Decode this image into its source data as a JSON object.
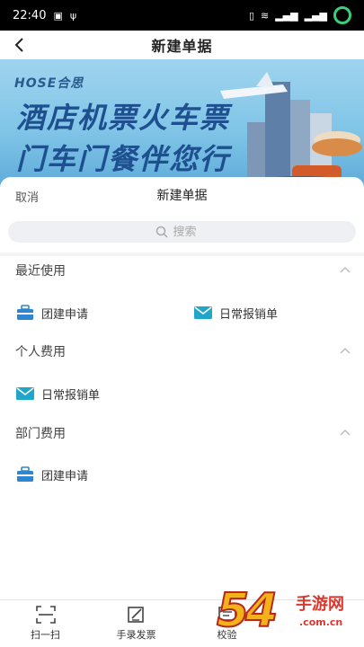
{
  "status_bar": {
    "time": "22:40"
  },
  "header": {
    "title": "新建单据"
  },
  "banner": {
    "logo": "HOSE合思",
    "line1": "酒店机票火车票",
    "line2": "门车门餐伴您行"
  },
  "sheet": {
    "cancel_label": "取消",
    "title": "新建单据",
    "search_placeholder": "搜索",
    "sections": [
      {
        "label": "最近使用",
        "items": [
          "团建申请",
          "日常报销单"
        ]
      },
      {
        "label": "个人费用",
        "items": [
          "日常报销单"
        ]
      },
      {
        "label": "部门费用",
        "items": [
          "团建申请"
        ]
      }
    ]
  },
  "bottom_nav": {
    "items": [
      "扫一扫",
      "手录发票",
      "校验"
    ]
  },
  "watermark": {
    "number": "54",
    "text": "手游网",
    "url": ".com.cn"
  },
  "colors": {
    "accent": "#2f7cc0",
    "mail_teal": "#1fa6c8",
    "briefcase_blue": "#2e86d1"
  }
}
